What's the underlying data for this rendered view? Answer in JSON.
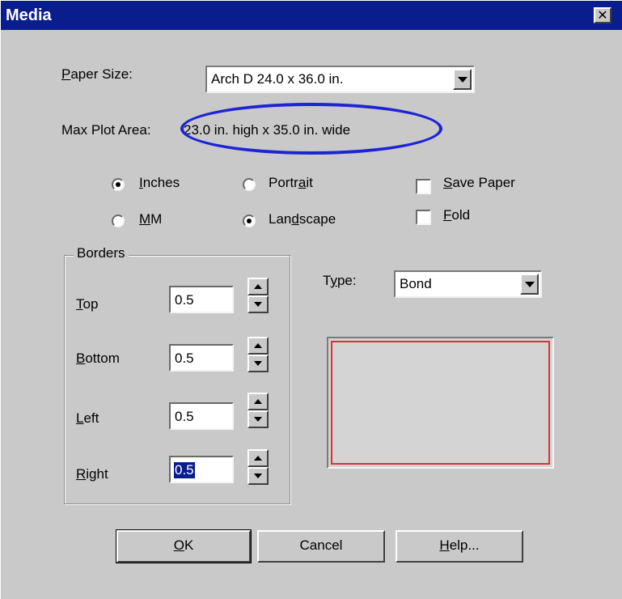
{
  "window": {
    "title": "Media",
    "close_glyph": "✕",
    "title_bar_color": "#0a1d8c",
    "face_color": "#c9c9c9"
  },
  "paper_size": {
    "label_u": "P",
    "label_rest": "aper Size:",
    "value": "Arch D 24.0 x 36.0 in."
  },
  "max_plot_area": {
    "label": "Max Plot Area:",
    "value": "23.0 in. high x 35.0 in. wide",
    "highlight_color": "#1c24d6"
  },
  "units": {
    "inches": {
      "pre": "",
      "u": "I",
      "rest": "nches",
      "selected": true
    },
    "mm": {
      "pre": "",
      "u": "M",
      "rest": "M",
      "selected": false
    }
  },
  "orientation": {
    "portrait": {
      "pre": "Portr",
      "u": "a",
      "rest": "it",
      "selected": false
    },
    "landscape": {
      "pre": "Lan",
      "u": "d",
      "rest": "scape",
      "selected": true
    }
  },
  "options": {
    "save_paper": {
      "u": "S",
      "rest": "ave Paper",
      "checked": false
    },
    "fold": {
      "u": "F",
      "rest": "old",
      "checked": false
    }
  },
  "borders": {
    "title": "Borders",
    "top": {
      "u": "T",
      "rest": "op",
      "value": "0.5"
    },
    "bottom": {
      "u": "B",
      "rest": "ottom",
      "value": "0.5"
    },
    "left": {
      "u": "L",
      "rest": "eft",
      "value": "0.5"
    },
    "right": {
      "u": "R",
      "rest": "ight",
      "value": "0.5",
      "selected": true
    }
  },
  "type": {
    "label_pre": "T",
    "label_u": "y",
    "label_rest": "pe:",
    "value": "Bond"
  },
  "preview": {
    "border_color": "#e03030"
  },
  "buttons": {
    "ok": {
      "u": "O",
      "rest": "K"
    },
    "cancel": {
      "label": "Cancel"
    },
    "help": {
      "u": "H",
      "rest": "elp..."
    }
  }
}
